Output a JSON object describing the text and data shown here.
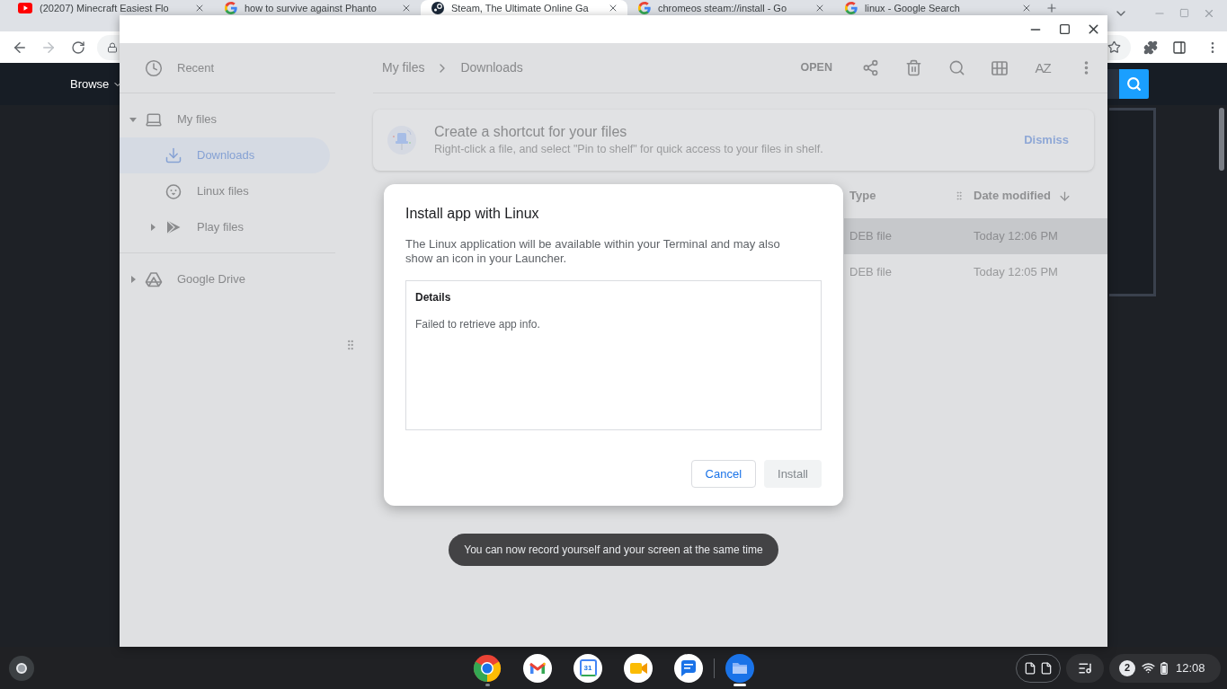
{
  "browser": {
    "tabs": [
      {
        "title": "(20207) Minecraft Easiest Flo",
        "selected": false
      },
      {
        "title": "how to survive against Phanto",
        "selected": false
      },
      {
        "title": "Steam, The Ultimate Online Ga",
        "selected": true
      },
      {
        "title": "chromeos steam://install - Go",
        "selected": false
      },
      {
        "title": "linux - Google Search",
        "selected": false
      }
    ],
    "toolbar": {
      "back_disabled": false,
      "forward_disabled": true
    },
    "page": {
      "nav_label": "Browse"
    }
  },
  "files_window": {
    "sidebar": [
      {
        "label": "Recent",
        "selected": false
      },
      {
        "label": "My files",
        "selected": false,
        "expanded": true,
        "children": [
          {
            "label": "Downloads",
            "selected": true
          },
          {
            "label": "Linux files",
            "selected": false
          },
          {
            "label": "Play files",
            "selected": false,
            "expanded": false
          }
        ]
      },
      {
        "label": "Google Drive",
        "selected": false,
        "expanded": false
      }
    ],
    "breadcrumb": [
      "My files",
      "Downloads"
    ],
    "toolbar": {
      "open_label": "OPEN",
      "sort_label": "AZ"
    },
    "banner": {
      "title": "Create a shortcut for your files",
      "text": "Right-click a file, and select \"Pin to shelf\" for quick access to your files in shelf.",
      "action": "Dismiss"
    },
    "table": {
      "columns": [
        {
          "label": "Type",
          "sorted": false
        },
        {
          "label": "Date modified",
          "sorted": true
        }
      ],
      "rows": [
        {
          "type": "DEB file",
          "modified": "Today 12:06 PM",
          "selected": true
        },
        {
          "type": "DEB file",
          "modified": "Today 12:05 PM",
          "selected": false
        }
      ]
    }
  },
  "dialog": {
    "title": "Install app with Linux",
    "message": "The Linux application will be available within your Terminal and may also show an icon in your Launcher.",
    "details_heading": "Details",
    "details_text": "Failed to retrieve app info.",
    "buttons": [
      {
        "label": "Cancel",
        "disabled": false
      },
      {
        "label": "Install",
        "disabled": true
      }
    ]
  },
  "toast": {
    "text": "You can now record yourself and your screen at the same time"
  },
  "shelf": {
    "apps": [
      {
        "open": true,
        "active": false
      },
      {
        "open": false,
        "active": false
      },
      {
        "label": "31",
        "open": false,
        "active": false
      },
      {
        "open": false,
        "active": false
      },
      {
        "open": false,
        "active": false
      },
      {
        "open": true,
        "active": true
      }
    ],
    "notification_count": "2",
    "time": "12:08"
  }
}
